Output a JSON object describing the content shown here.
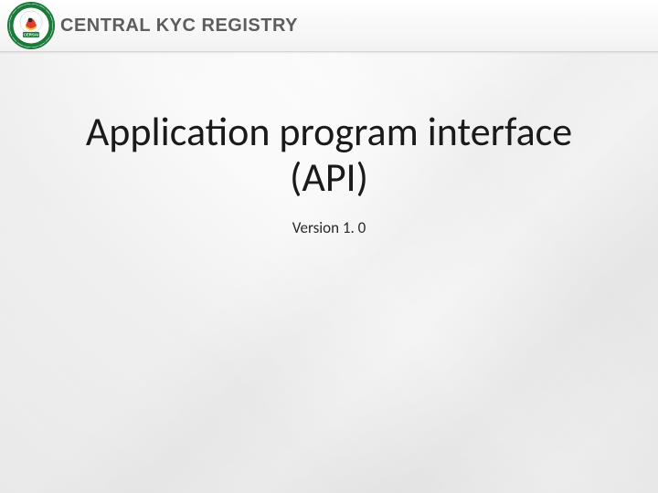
{
  "header": {
    "title": "CENTRAL KYC REGISTRY",
    "logo_label": "CERSAI"
  },
  "main": {
    "title_line1": "Application program interface",
    "title_line2": "(API)",
    "version": "Version 1. 0"
  }
}
